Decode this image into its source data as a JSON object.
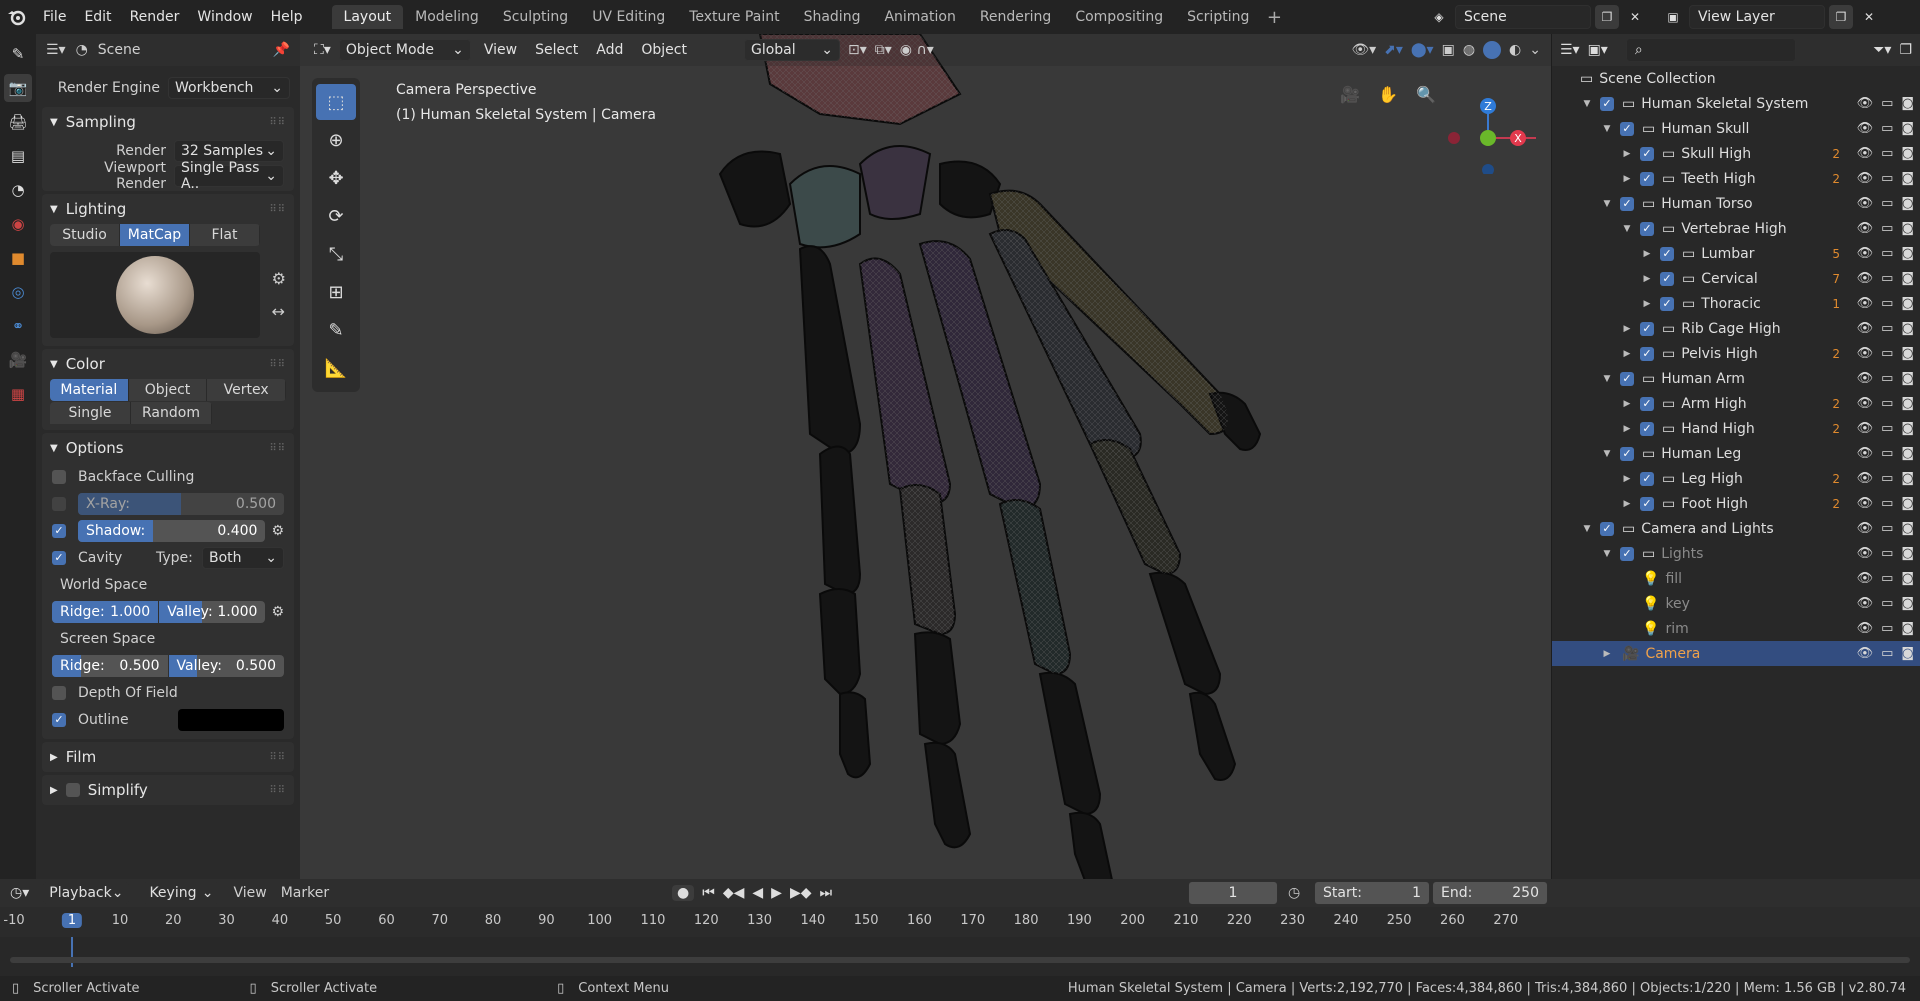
{
  "menu": [
    "File",
    "Edit",
    "Render",
    "Window",
    "Help"
  ],
  "workspaces": [
    "Layout",
    "Modeling",
    "Sculpting",
    "UV Editing",
    "Texture Paint",
    "Shading",
    "Animation",
    "Rendering",
    "Compositing",
    "Scripting"
  ],
  "scene_name": "Scene",
  "view_layer": "View Layer",
  "props": {
    "header": "Scene",
    "render_engine_label": "Render Engine",
    "render_engine": "Workbench",
    "sampling": {
      "title": "Sampling",
      "render_label": "Render",
      "render": "32 Samples",
      "viewport_label": "Viewport Render",
      "viewport": "Single Pass A.."
    },
    "lighting": {
      "title": "Lighting",
      "modes": [
        "Studio",
        "MatCap",
        "Flat"
      ],
      "active": "MatCap"
    },
    "color": {
      "title": "Color",
      "row1": [
        "Material",
        "Object",
        "Vertex"
      ],
      "row2": [
        "Single",
        "Random"
      ],
      "active": "Material"
    },
    "options": {
      "title": "Options",
      "backface": "Backface Culling",
      "xray_label": "X-Ray:",
      "xray_val": "0.500",
      "xray_fill": 0.5,
      "shadow_label": "Shadow:",
      "shadow_val": "0.400",
      "shadow_fill": 0.4,
      "cavity": "Cavity",
      "type_label": "Type:",
      "type_val": "Both",
      "world_space": "World Space",
      "ws_ridge_label": "Ridge:",
      "ws_ridge": "1.000",
      "ws_valley_label": "Valley:",
      "ws_valley": "1.000",
      "screen_space": "Screen Space",
      "ss_ridge_label": "Ridge:",
      "ss_ridge": "0.500",
      "ss_valley_label": "Valley:",
      "ss_valley": "0.500",
      "dof": "Depth Of Field",
      "outline": "Outline"
    },
    "film": "Film",
    "simplify": "Simplify"
  },
  "viewport": {
    "mode": "Object Mode",
    "menus": [
      "View",
      "Select",
      "Add",
      "Object"
    ],
    "orientation": "Global",
    "info_line1": "Camera Perspective",
    "info_line2": "(1) Human Skeletal System | Camera",
    "axis_x": "X",
    "axis_z": "Z"
  },
  "outliner": {
    "root": "Scene Collection",
    "rows": [
      {
        "name": "Human Skeletal System",
        "depth": 1,
        "open": true
      },
      {
        "name": "Human Skull",
        "depth": 2,
        "open": true
      },
      {
        "name": "Skull High",
        "depth": 3,
        "open": false,
        "badge": "2"
      },
      {
        "name": "Teeth High",
        "depth": 3,
        "open": false,
        "badge": "2"
      },
      {
        "name": "Human Torso",
        "depth": 2,
        "open": true
      },
      {
        "name": "Vertebrae High",
        "depth": 3,
        "open": true
      },
      {
        "name": "Lumbar",
        "depth": 4,
        "open": false,
        "badge": "5"
      },
      {
        "name": "Cervical",
        "depth": 4,
        "open": false,
        "badge": "7"
      },
      {
        "name": "Thoracic",
        "depth": 4,
        "open": false,
        "badge": "1"
      },
      {
        "name": "Rib Cage High",
        "depth": 3,
        "open": false
      },
      {
        "name": "Pelvis High",
        "depth": 3,
        "open": false,
        "badge": "2"
      },
      {
        "name": "Human Arm",
        "depth": 2,
        "open": true
      },
      {
        "name": "Arm High",
        "depth": 3,
        "open": false,
        "badge": "2"
      },
      {
        "name": "Hand High",
        "depth": 3,
        "open": false,
        "badge": "2"
      },
      {
        "name": "Human Leg",
        "depth": 2,
        "open": true
      },
      {
        "name": "Leg High",
        "depth": 3,
        "open": false,
        "badge": "2"
      },
      {
        "name": "Foot High",
        "depth": 3,
        "open": false,
        "badge": "2"
      },
      {
        "name": "Camera and Lights",
        "depth": 1,
        "open": true
      },
      {
        "name": "Lights",
        "depth": 2,
        "open": true,
        "dim": true
      },
      {
        "name": "fill",
        "depth": 3,
        "dim": true
      },
      {
        "name": "key",
        "depth": 3,
        "dim": true
      },
      {
        "name": "rim",
        "depth": 3,
        "dim": true
      },
      {
        "name": "Camera",
        "depth": 2,
        "open": false,
        "selected": true
      }
    ]
  },
  "timeline": {
    "menus": [
      "Playback",
      "Keying",
      "View",
      "Marker"
    ],
    "current_frame": "1",
    "start_label": "Start:",
    "start": "1",
    "end_label": "End:",
    "end": "250",
    "ticks": [
      "-10",
      "1",
      "10",
      "20",
      "30",
      "40",
      "50",
      "60",
      "70",
      "80",
      "90",
      "100",
      "110",
      "120",
      "130",
      "140",
      "150",
      "160",
      "170",
      "180",
      "190",
      "200",
      "210",
      "220",
      "230",
      "240",
      "250",
      "260",
      "270"
    ]
  },
  "status": {
    "left1": "Scroller Activate",
    "left2": "Scroller Activate",
    "left3": "Context Menu",
    "right": "Human Skeletal System | Camera | Verts:2,192,770 | Faces:4,384,860 | Tris:4,384,860 | Objects:1/220 | Mem: 1.56 GB | v2.80.74"
  }
}
